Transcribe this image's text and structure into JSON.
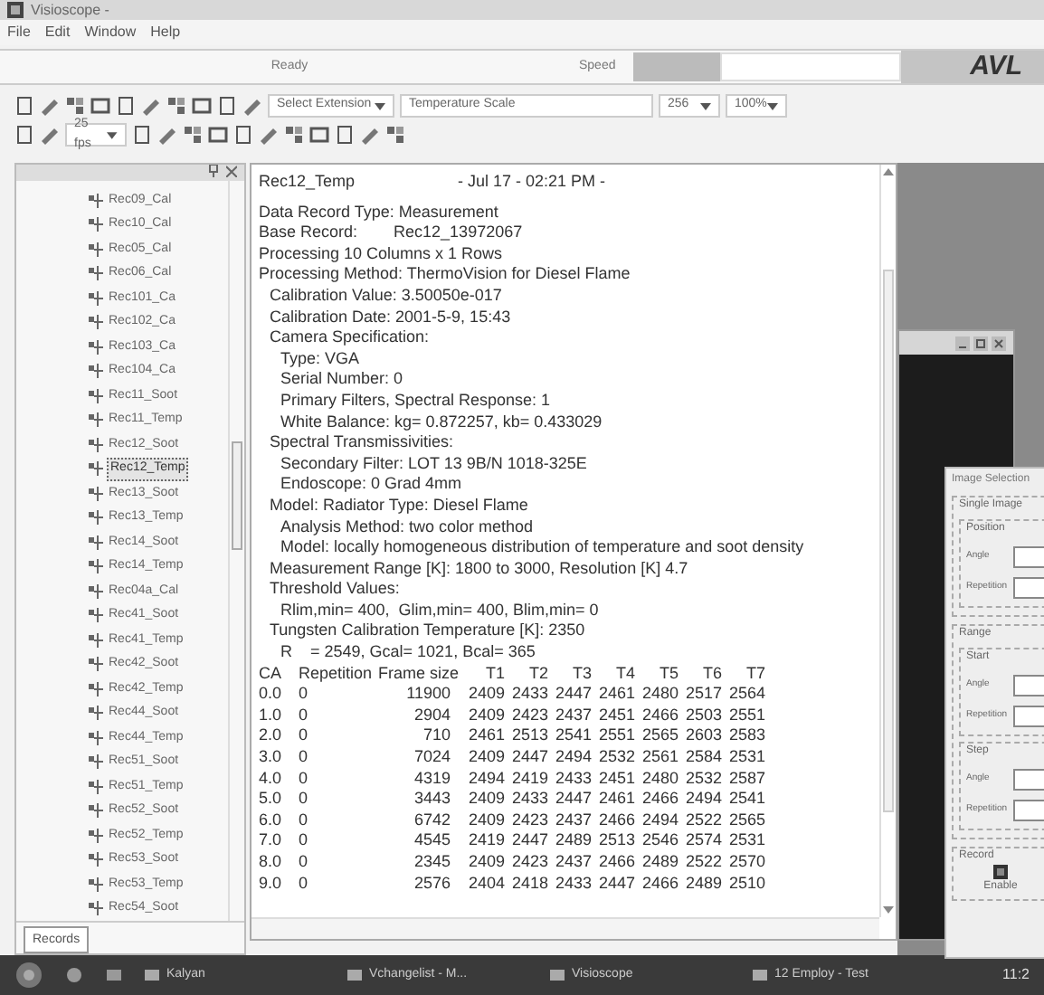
{
  "window": {
    "title": "Visioscope -"
  },
  "menu": [
    "File",
    "Edit",
    "Window",
    "Help"
  ],
  "status_bar": {
    "text": "Ready",
    "speed_label": "Speed",
    "logo": "AVL"
  },
  "toolbar": {
    "extension": "Select Extension",
    "scale": "Temperature Scale",
    "palette": "256",
    "zoom": "100%",
    "frame_rate": "25 fps"
  },
  "records": {
    "tab": "Records",
    "items": [
      {
        "label": "Rec09_Cal",
        "selected": false
      },
      {
        "label": "Rec10_Cal",
        "selected": false
      },
      {
        "label": "Rec05_Cal",
        "selected": false
      },
      {
        "label": "Rec06_Cal",
        "selected": false
      },
      {
        "label": "Rec101_Ca",
        "selected": false
      },
      {
        "label": "Rec102_Ca",
        "selected": false
      },
      {
        "label": "Rec103_Ca",
        "selected": false
      },
      {
        "label": "Rec104_Ca",
        "selected": false
      },
      {
        "label": "Rec11_Soot",
        "selected": false
      },
      {
        "label": "Rec11_Temp",
        "selected": false
      },
      {
        "label": "Rec12_Soot",
        "selected": false
      },
      {
        "label": "Rec12_Temp",
        "selected": true
      },
      {
        "label": "Rec13_Soot",
        "selected": false
      },
      {
        "label": "Rec13_Temp",
        "selected": false
      },
      {
        "label": "Rec14_Soot",
        "selected": false
      },
      {
        "label": "Rec14_Temp",
        "selected": false
      },
      {
        "label": "Rec04a_Cal",
        "selected": false
      },
      {
        "label": "Rec41_Soot",
        "selected": false
      },
      {
        "label": "Rec41_Temp",
        "selected": false
      },
      {
        "label": "Rec42_Soot",
        "selected": false
      },
      {
        "label": "Rec42_Temp",
        "selected": false
      },
      {
        "label": "Rec44_Soot",
        "selected": false
      },
      {
        "label": "Rec44_Temp",
        "selected": false
      },
      {
        "label": "Rec51_Soot",
        "selected": false
      },
      {
        "label": "Rec51_Temp",
        "selected": false
      },
      {
        "label": "Rec52_Soot",
        "selected": false
      },
      {
        "label": "Rec52_Temp",
        "selected": false
      },
      {
        "label": "Rec53_Soot",
        "selected": false
      },
      {
        "label": "Rec53_Temp",
        "selected": false
      },
      {
        "label": "Rec54_Soot",
        "selected": false
      }
    ]
  },
  "report": {
    "title": "Rec12_Temp",
    "timestamp": "- Jul 17 - 02:21 PM -",
    "lines": [
      {
        "text": "Data Record Type: Measurement"
      },
      {
        "text": "Base Record:        Rec12_13972067"
      },
      {
        "text": "Processing 10 Columns x 1 Rows"
      },
      {
        "text": "Processing Method: ThermoVision for Diesel Flame",
        "children": [
          {
            "text": "Calibration Value: 3.50050e-017"
          },
          {
            "text": "Calibration Date: 2001-5-9, 15:43"
          },
          {
            "text": "Camera Specification:",
            "children": [
              {
                "text": "Type: VGA"
              },
              {
                "text": "Serial Number: 0"
              },
              {
                "text": "Primary Filters, Spectral Response: 1"
              },
              {
                "text": "White Balance: kg= 0.872257, kb= 0.433029"
              }
            ]
          },
          {
            "text": "Spectral Transmissivities:",
            "children": [
              {
                "text": "Secondary Filter: LOT 13 9B/N 1018-325E"
              },
              {
                "text": "Endoscope: 0 Grad 4mm"
              }
            ]
          },
          {
            "text": "Model: Radiator Type: Diesel Flame",
            "children": [
              {
                "text": "Analysis Method: two color method"
              },
              {
                "text": "Model: locally homogeneous distribution of temperature and soot density"
              }
            ]
          },
          {
            "text": "Measurement Range [K]: 1800 to 3000, Resolution [K] 4.7"
          },
          {
            "text": "Threshold Values:",
            "children": [
              {
                "text": "Rlim,min= 400,  Glim,min= 400, Blim,min= 0"
              }
            ]
          },
          {
            "text": "Tungsten Calibration Temperature [K]: 2350",
            "children": [
              {
                "text": "R    = 2549, Gcal= 1021, Bcal= 365"
              }
            ]
          }
        ]
      }
    ],
    "table": {
      "columns": [
        "CA",
        "Repetition",
        "Frame size",
        "T1",
        "T2",
        "T3",
        "T4",
        "T5",
        "T6",
        "T7"
      ],
      "rows": [
        [
          "0.0",
          "0",
          "11900",
          "2409",
          "2433",
          "2447",
          "2461",
          "2480",
          "2517",
          "2564"
        ],
        [
          "1.0",
          "0",
          "2904",
          "2409",
          "2423",
          "2437",
          "2451",
          "2466",
          "2503",
          "2551"
        ],
        [
          "2.0",
          "0",
          "710",
          "2461",
          "2513",
          "2541",
          "2551",
          "2565",
          "2603",
          "2583"
        ],
        [
          "3.0",
          "0",
          "7024",
          "2409",
          "2447",
          "2494",
          "2532",
          "2561",
          "2584",
          "2531"
        ],
        [
          "4.0",
          "0",
          "4319",
          "2494",
          "2419",
          "2433",
          "2451",
          "2480",
          "2532",
          "2587"
        ],
        [
          "5.0",
          "0",
          "3443",
          "2409",
          "2433",
          "2447",
          "2461",
          "2466",
          "2494",
          "2541"
        ],
        [
          "6.0",
          "0",
          "6742",
          "2409",
          "2423",
          "2437",
          "2466",
          "2494",
          "2522",
          "2565"
        ],
        [
          "7.0",
          "0",
          "4545",
          "2419",
          "2447",
          "2489",
          "2513",
          "2546",
          "2574",
          "2531"
        ],
        [
          "8.0",
          "0",
          "2345",
          "2409",
          "2423",
          "2437",
          "2466",
          "2489",
          "2522",
          "2570"
        ],
        [
          "9.0",
          "0",
          "2576",
          "2404",
          "2418",
          "2433",
          "2447",
          "2466",
          "2489",
          "2510"
        ]
      ]
    }
  },
  "dialog": {
    "title": "Image Selection",
    "groups": [
      {
        "title": "Single Image",
        "subgroups": [
          {
            "title": "Position",
            "fields": [
              "Angle",
              "Repetition"
            ]
          }
        ]
      },
      {
        "title": "Range",
        "subgroups": [
          {
            "title": "Start",
            "fields": [
              "Angle",
              "Repetition"
            ]
          },
          {
            "title": "Step",
            "fields": [
              "Angle",
              "Repetition"
            ]
          }
        ]
      }
    ],
    "record": {
      "title": "Record",
      "button": "Enable"
    }
  },
  "taskbar": {
    "items": [
      "Kalyan",
      "Vchangelist - M...",
      "Visioscope",
      "12 Employ - Test"
    ],
    "clock": "11:2"
  }
}
